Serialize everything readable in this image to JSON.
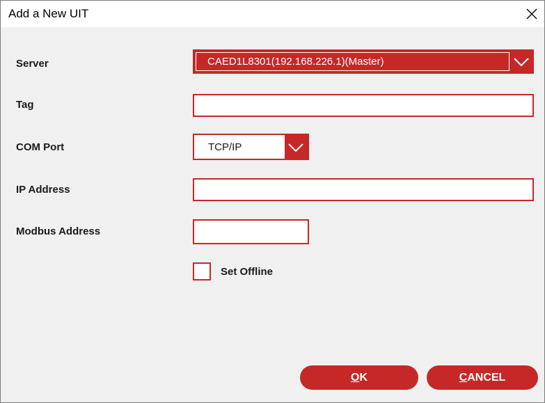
{
  "window": {
    "title": "Add a New UIT",
    "close_icon": "close-icon"
  },
  "form": {
    "server": {
      "label": "Server",
      "value": "CAED1L8301(192.168.226.1)(Master)"
    },
    "tag": {
      "label": "Tag",
      "value": ""
    },
    "com_port": {
      "label": "COM Port",
      "value": "TCP/IP"
    },
    "ip_address": {
      "label": "IP Address",
      "value": ""
    },
    "modbus_address": {
      "label": "Modbus Address",
      "value": ""
    },
    "set_offline": {
      "label": "Set Offline",
      "checked": false
    }
  },
  "buttons": {
    "ok": {
      "mnemonic": "O",
      "rest": "K"
    },
    "cancel": {
      "mnemonic": "C",
      "rest": "ANCEL"
    }
  },
  "colors": {
    "accent": "#c62828",
    "background": "#f0f0f0"
  }
}
